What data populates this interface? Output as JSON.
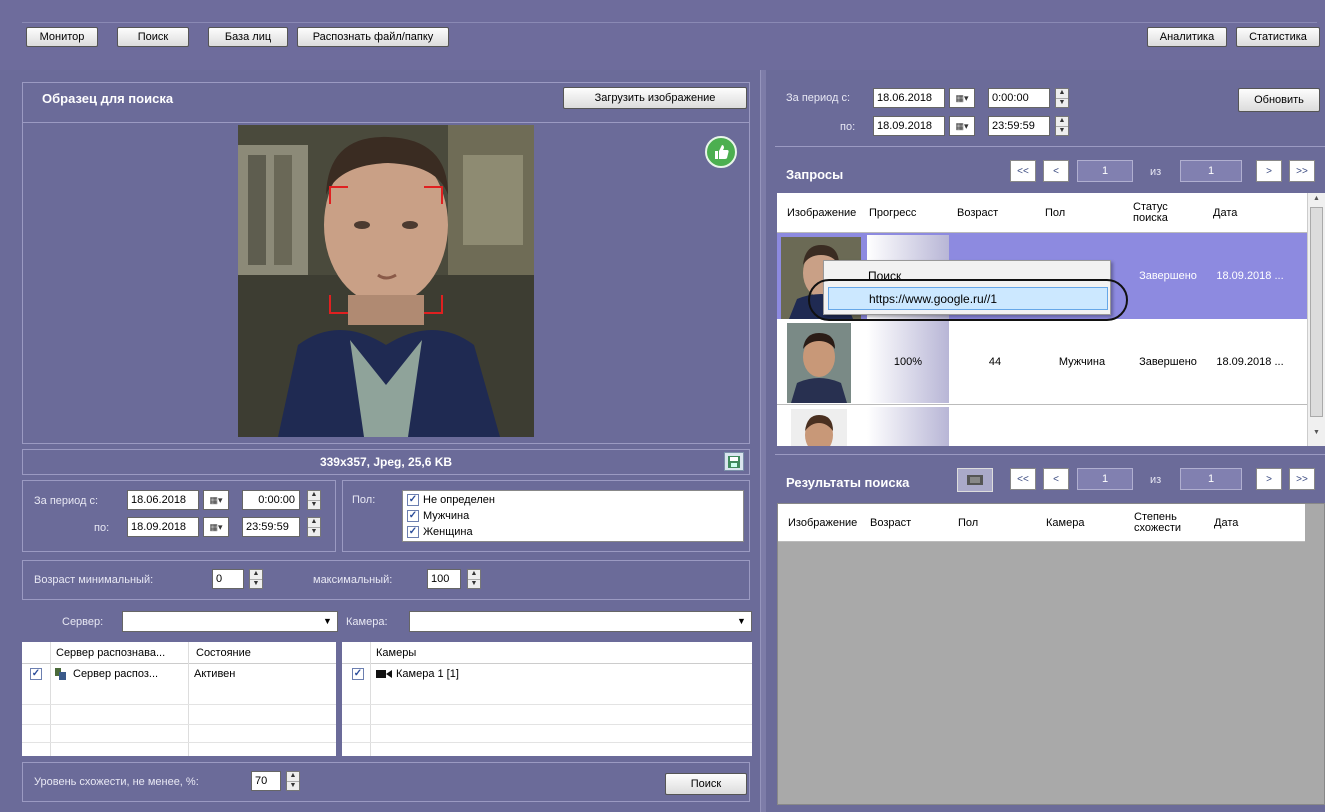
{
  "toolbar": {
    "buttons": [
      "Монитор",
      "Поиск",
      "База лиц",
      "Распознать файл/папку"
    ],
    "right_buttons": [
      "Аналитика",
      "Статистика"
    ]
  },
  "sample": {
    "title": "Образец для поиска",
    "upload_label": "Загрузить изображение",
    "image_info": "339x357, Jpeg, 25,6 KB"
  },
  "filters": {
    "period_from_label": "За период с:",
    "period_to_label": "по:",
    "date_from": "18.06.2018",
    "time_from": "0:00:00",
    "date_to": "18.09.2018",
    "time_to": "23:59:59",
    "gender_label": "Пол:",
    "genders": [
      "Не определен",
      "Мужчина",
      "Женщина"
    ],
    "age_min_label": "Возраст минимальный:",
    "age_min": "0",
    "age_max_label": "максимальный:",
    "age_max": "100",
    "server_label": "Сервер:",
    "server_value": "",
    "camera_label": "Камера:",
    "camera_value": ""
  },
  "servers_table": {
    "headers": [
      "Сервер распознава...",
      "Состояние"
    ],
    "rows": [
      {
        "name": "Сервер распоз...",
        "state": "Активен"
      }
    ]
  },
  "cameras_table": {
    "headers": [
      "Камеры"
    ],
    "rows": [
      {
        "name": "Камера 1 [1]"
      }
    ]
  },
  "similarity": {
    "label": "Уровень схожести, не менее, %:",
    "value": "70",
    "search_label": "Поиск"
  },
  "right_filter": {
    "period_from_label": "За период с:",
    "period_to_label": "по:",
    "date_from": "18.06.2018",
    "time_from": "0:00:00",
    "date_to": "18.09.2018",
    "time_to": "23:59:59",
    "refresh_label": "Обновить"
  },
  "requests": {
    "title": "Запросы",
    "pager": {
      "first": "<<",
      "prev": "<",
      "page": "1",
      "of": "из",
      "total": "1",
      "next": ">",
      "last": ">>"
    },
    "headers": [
      "Изображение",
      "Прогресс",
      "Возраст",
      "Пол",
      "Статус поиска",
      "Дата"
    ],
    "rows": [
      {
        "progress": "",
        "age": "",
        "gender": "",
        "status": "Завершено",
        "date": "18.09.2018 ..."
      },
      {
        "progress": "100%",
        "age": "44",
        "gender": "Мужчина",
        "status": "Завершено",
        "date": "18.09.2018 ..."
      }
    ],
    "context_menu": [
      "Поиск",
      "https://www.google.ru//1"
    ]
  },
  "results": {
    "title": "Результаты поиска",
    "pager": {
      "first": "<<",
      "prev": "<",
      "page": "1",
      "of": "из",
      "total": "1",
      "next": ">",
      "last": ">>"
    },
    "headers": [
      "Изображение",
      "Возраст",
      "Пол",
      "Камера",
      "Степень схожести",
      "Дата"
    ]
  },
  "colors": {
    "background": "#6b6b99",
    "selected_row": "#8d8ae0",
    "context_highlight": "#cce8ff",
    "like_badge": "#4caf50"
  }
}
